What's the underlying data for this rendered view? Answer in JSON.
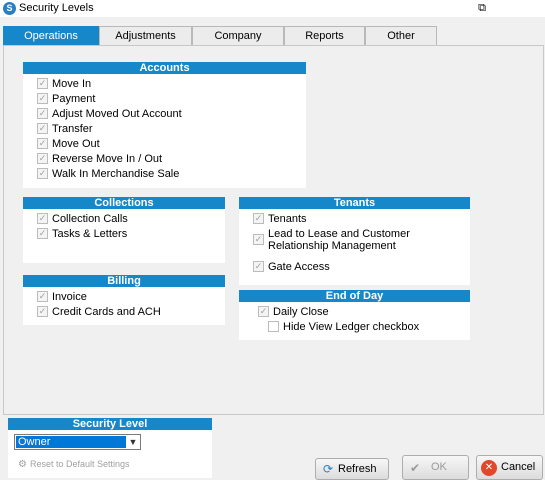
{
  "window": {
    "title": "Security Levels",
    "app_icon": "storage-app-icon",
    "pin_icon": "pin-icon"
  },
  "tabs": [
    {
      "label": "Operations",
      "active": true
    },
    {
      "label": "Adjustments",
      "active": false
    },
    {
      "label": "Company",
      "active": false
    },
    {
      "label": "Reports",
      "active": false
    },
    {
      "label": "Other",
      "active": false
    }
  ],
  "accounts": {
    "title": "Accounts",
    "items": [
      "Move In",
      "Payment",
      "Adjust Moved Out Account",
      "Transfer",
      "Move Out",
      "Reverse Move In / Out",
      "Walk In Merchandise Sale"
    ]
  },
  "collections": {
    "title": "Collections",
    "items": [
      "Collection Calls",
      "Tasks & Letters"
    ]
  },
  "billing": {
    "title": "Billing",
    "items": [
      "Invoice",
      "Credit Cards and ACH"
    ]
  },
  "tenants": {
    "title": "Tenants",
    "items": [
      "Tenants",
      "Lead to Lease and Customer",
      "Relationship Management",
      "Gate Access"
    ]
  },
  "end_of_day": {
    "title": "End of Day",
    "items": [
      {
        "label": "Daily Close",
        "checked": true
      },
      {
        "label": "Hide View Ledger checkbox",
        "checked": false
      }
    ]
  },
  "security_level": {
    "title": "Security Level",
    "selected": "Owner",
    "reset_label": "Reset to Default Settings"
  },
  "buttons": {
    "refresh": "Refresh",
    "ok": "OK",
    "cancel": "Cancel"
  },
  "colors": {
    "accent": "#1687c9",
    "cancel_icon": "#e0482c",
    "ok_icon": "#9a9a9a"
  }
}
